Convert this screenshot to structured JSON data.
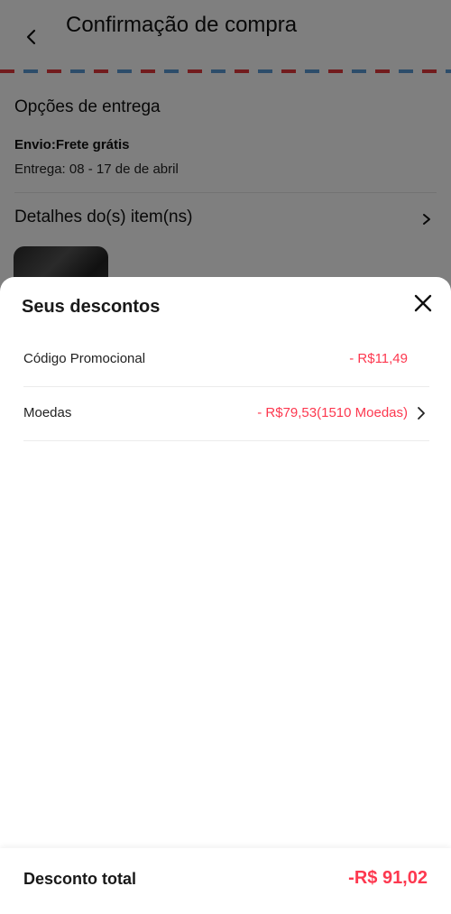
{
  "header": {
    "title": "Confirmação de compra",
    "back_icon": "chevron-left-icon"
  },
  "delivery": {
    "title": "Opções de entrega",
    "shipping": "Envio:Frete grátis",
    "date": "Entrega: 08 - 17 de de abril"
  },
  "items": {
    "title": "Detalhes do(s) item(ns)",
    "chevron_icon": "chevron-right-icon"
  },
  "sheet": {
    "title": "Seus descontos",
    "close_icon": "close-icon",
    "rows": [
      {
        "label": "Código Promocional",
        "value": "- R$11,49"
      },
      {
        "label": "Moedas",
        "value": "- R$79,53(1510 Moedas)"
      }
    ]
  },
  "footer": {
    "label": "Desconto total",
    "value": "-R$ 91,02"
  },
  "colors": {
    "accent": "#fd384f",
    "overlay": "#000000",
    "airmail_red": "#e4393c",
    "airmail_blue": "#5b9bd5"
  }
}
